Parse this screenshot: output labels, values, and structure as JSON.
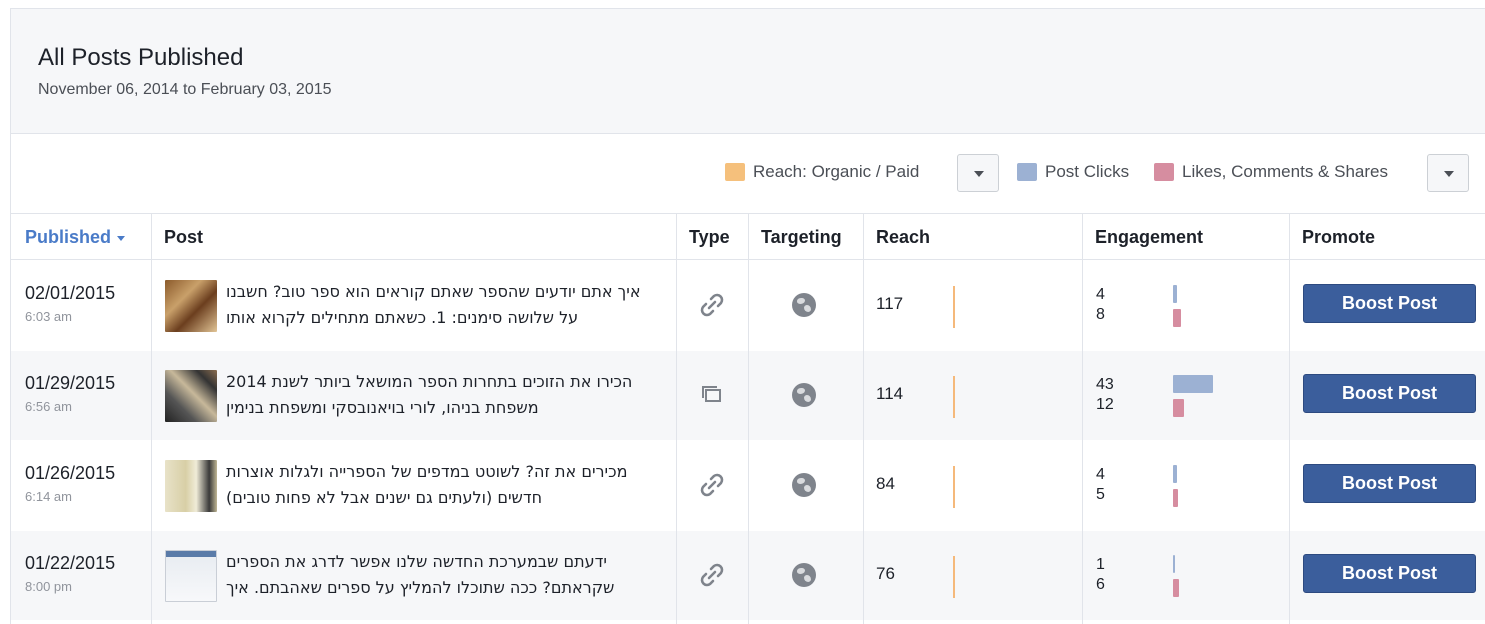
{
  "header": {
    "title": "All Posts Published",
    "date_range": "November 06, 2014 to February 03, 2015"
  },
  "legend": {
    "reach_label": "Reach: Organic / Paid",
    "clicks_label": "Post Clicks",
    "likes_label": "Likes, Comments & Shares",
    "reach_color": "#f5c07c",
    "clicks_color": "#9cb1d3",
    "likes_color": "#d68da0"
  },
  "columns": {
    "published": "Published",
    "post": "Post",
    "type": "Type",
    "targeting": "Targeting",
    "reach": "Reach",
    "engagement": "Engagement",
    "promote": "Promote"
  },
  "rows": [
    {
      "date": "02/01/2015",
      "time": "6:03 am",
      "text": "איך אתם יודעים שהספר שאתם קוראים הוא ספר טוב? חשבנו על שלושה סימנים: 1. כשאתם מתחילים לקרוא אותו",
      "type_icon": "link-icon",
      "targeting_icon": "globe-icon",
      "reach": "117",
      "clicks": "4",
      "likes": "8",
      "clicks_fraction": 0.09,
      "likes_fraction": 0.19,
      "boost_label": "Boost Post"
    },
    {
      "date": "01/29/2015",
      "time": "6:56 am",
      "text": "הכירו את הזוכים בתחרות הספר המושאל ביותר לשנת 2014 משפחת בניהו, לורי בויאנובסקי ומשפחת בנימין",
      "type_icon": "album-icon",
      "targeting_icon": "globe-icon",
      "reach": "114",
      "clicks": "43",
      "likes": "12",
      "clicks_fraction": 1.0,
      "likes_fraction": 0.28,
      "boost_label": "Boost Post"
    },
    {
      "date": "01/26/2015",
      "time": "6:14 am",
      "text": "מכירים את זה? לשוטט במדפים של הספרייה ולגלות אוצרות חדשים (ולעתים גם ישנים אבל לא פחות טובים)",
      "type_icon": "link-icon",
      "targeting_icon": "globe-icon",
      "reach": "84",
      "clicks": "4",
      "likes": "5",
      "clicks_fraction": 0.09,
      "likes_fraction": 0.12,
      "boost_label": "Boost Post"
    },
    {
      "date": "01/22/2015",
      "time": "8:00 pm",
      "text": "ידעתם שבמערכת החדשה שלנו אפשר לדרג את הספרים שקראתם? ככה שתוכלו להמליץ על ספרים שאהבתם. איך",
      "type_icon": "link-icon",
      "targeting_icon": "globe-icon",
      "reach": "76",
      "clicks": "1",
      "likes": "6",
      "clicks_fraction": 0.02,
      "likes_fraction": 0.14,
      "boost_label": "Boost Post"
    }
  ]
}
